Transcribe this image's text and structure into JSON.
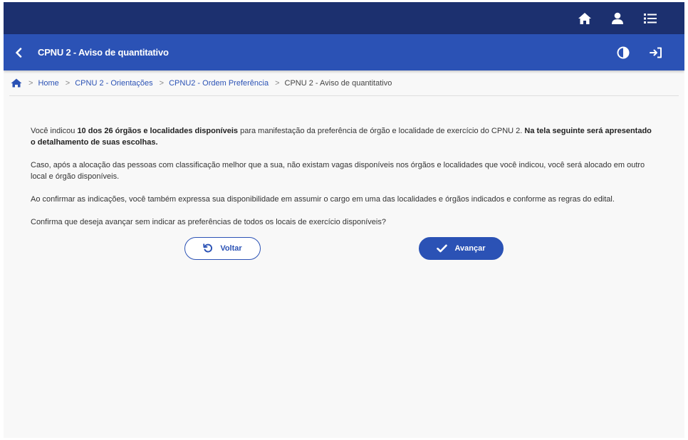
{
  "topbar": {
    "icons": [
      "home-icon",
      "user-icon",
      "list-icon"
    ]
  },
  "titlebar": {
    "title": "CPNU 2 - Aviso de quantitativo",
    "icons": [
      "back-chevron-icon",
      "contrast-icon",
      "sign-in-icon"
    ]
  },
  "breadcrumb": {
    "items": [
      {
        "label": "Home"
      },
      {
        "label": "CPNU 2 - Orientações"
      },
      {
        "label": "CPNU2 - Ordem Preferência"
      },
      {
        "label": "CPNU 2 - Aviso de quantitativo"
      }
    ],
    "separator": ">"
  },
  "message": {
    "p1_part1": "Você indicou ",
    "p1_bold1": "10 dos 26 órgãos e localidades disponíveis",
    "p1_part2": " para manifestação da preferência de órgão e localidade de exercício do CPNU 2. ",
    "p1_bold2": "Na tela seguinte será apresentado o detalhamento de suas escolhas.",
    "p2": "Caso, após a alocação das pessoas com classificação melhor que a sua, não existam vagas disponíveis nos órgãos e localidades que você indicou, você será alocado em outro local e órgão disponíveis.",
    "p3": "Ao confirmar as indicações, você também expressa sua disponibilidade em assumir o cargo em uma das localidades e órgãos indicados e conforme as regras do edital.",
    "p4": "Confirma que deseja avançar sem indicar as preferências de todos os locais de exercício disponíveis?"
  },
  "actions": {
    "back_label": "Voltar",
    "next_label": "Avançar"
  },
  "colors": {
    "topbar": "#1c306f",
    "primary": "#2b52b5",
    "background": "#f8f8f8"
  }
}
